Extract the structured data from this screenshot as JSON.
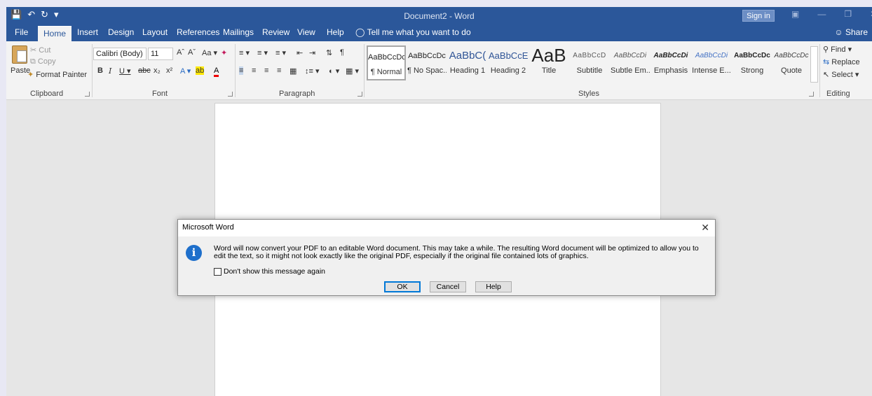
{
  "window": {
    "title": "Document2  -  Word",
    "sign_in": "Sign in",
    "share": "Share"
  },
  "tabs": [
    "File",
    "Home",
    "Insert",
    "Design",
    "Layout",
    "References",
    "Mailings",
    "Review",
    "View",
    "Help"
  ],
  "tell_me": "Tell me what you want to do",
  "clipboard": {
    "label": "Clipboard",
    "paste": "Paste",
    "cut": "Cut",
    "copy": "Copy",
    "format_painter": "Format Painter"
  },
  "font": {
    "label": "Font",
    "font_name": "Calibri (Body)",
    "font_size": "11",
    "change_case": "Aa"
  },
  "paragraph": {
    "label": "Paragraph"
  },
  "styles": {
    "label": "Styles",
    "items": [
      {
        "sample": "AaBbCcDc",
        "name": "¶ Normal"
      },
      {
        "sample": "AaBbCcDc",
        "name": "¶ No Spac..."
      },
      {
        "sample": "AaBbC(",
        "name": "Heading 1"
      },
      {
        "sample": "AaBbCcE",
        "name": "Heading 2"
      },
      {
        "sample": "AaB",
        "name": "Title"
      },
      {
        "sample": "AaBbCcD",
        "name": "Subtitle"
      },
      {
        "sample": "AaBbCcDi",
        "name": "Subtle Em..."
      },
      {
        "sample": "AaBbCcDi",
        "name": "Emphasis"
      },
      {
        "sample": "AaBbCcDi",
        "name": "Intense E..."
      },
      {
        "sample": "AaBbCcDc",
        "name": "Strong"
      },
      {
        "sample": "AaBbCcDc",
        "name": "Quote"
      }
    ]
  },
  "editing": {
    "label": "Editing",
    "find": "Find",
    "replace": "Replace",
    "select": "Select"
  },
  "dialog": {
    "title": "Microsoft Word",
    "message": "Word will now convert your PDF to an editable Word document. This may take a while. The resulting Word document will be optimized to allow you to edit the text, so it might not look exactly like the original PDF, especially if the original file contained lots of graphics.",
    "checkbox_label": "Don't show this message again",
    "ok": "OK",
    "cancel": "Cancel",
    "help": "Help"
  }
}
